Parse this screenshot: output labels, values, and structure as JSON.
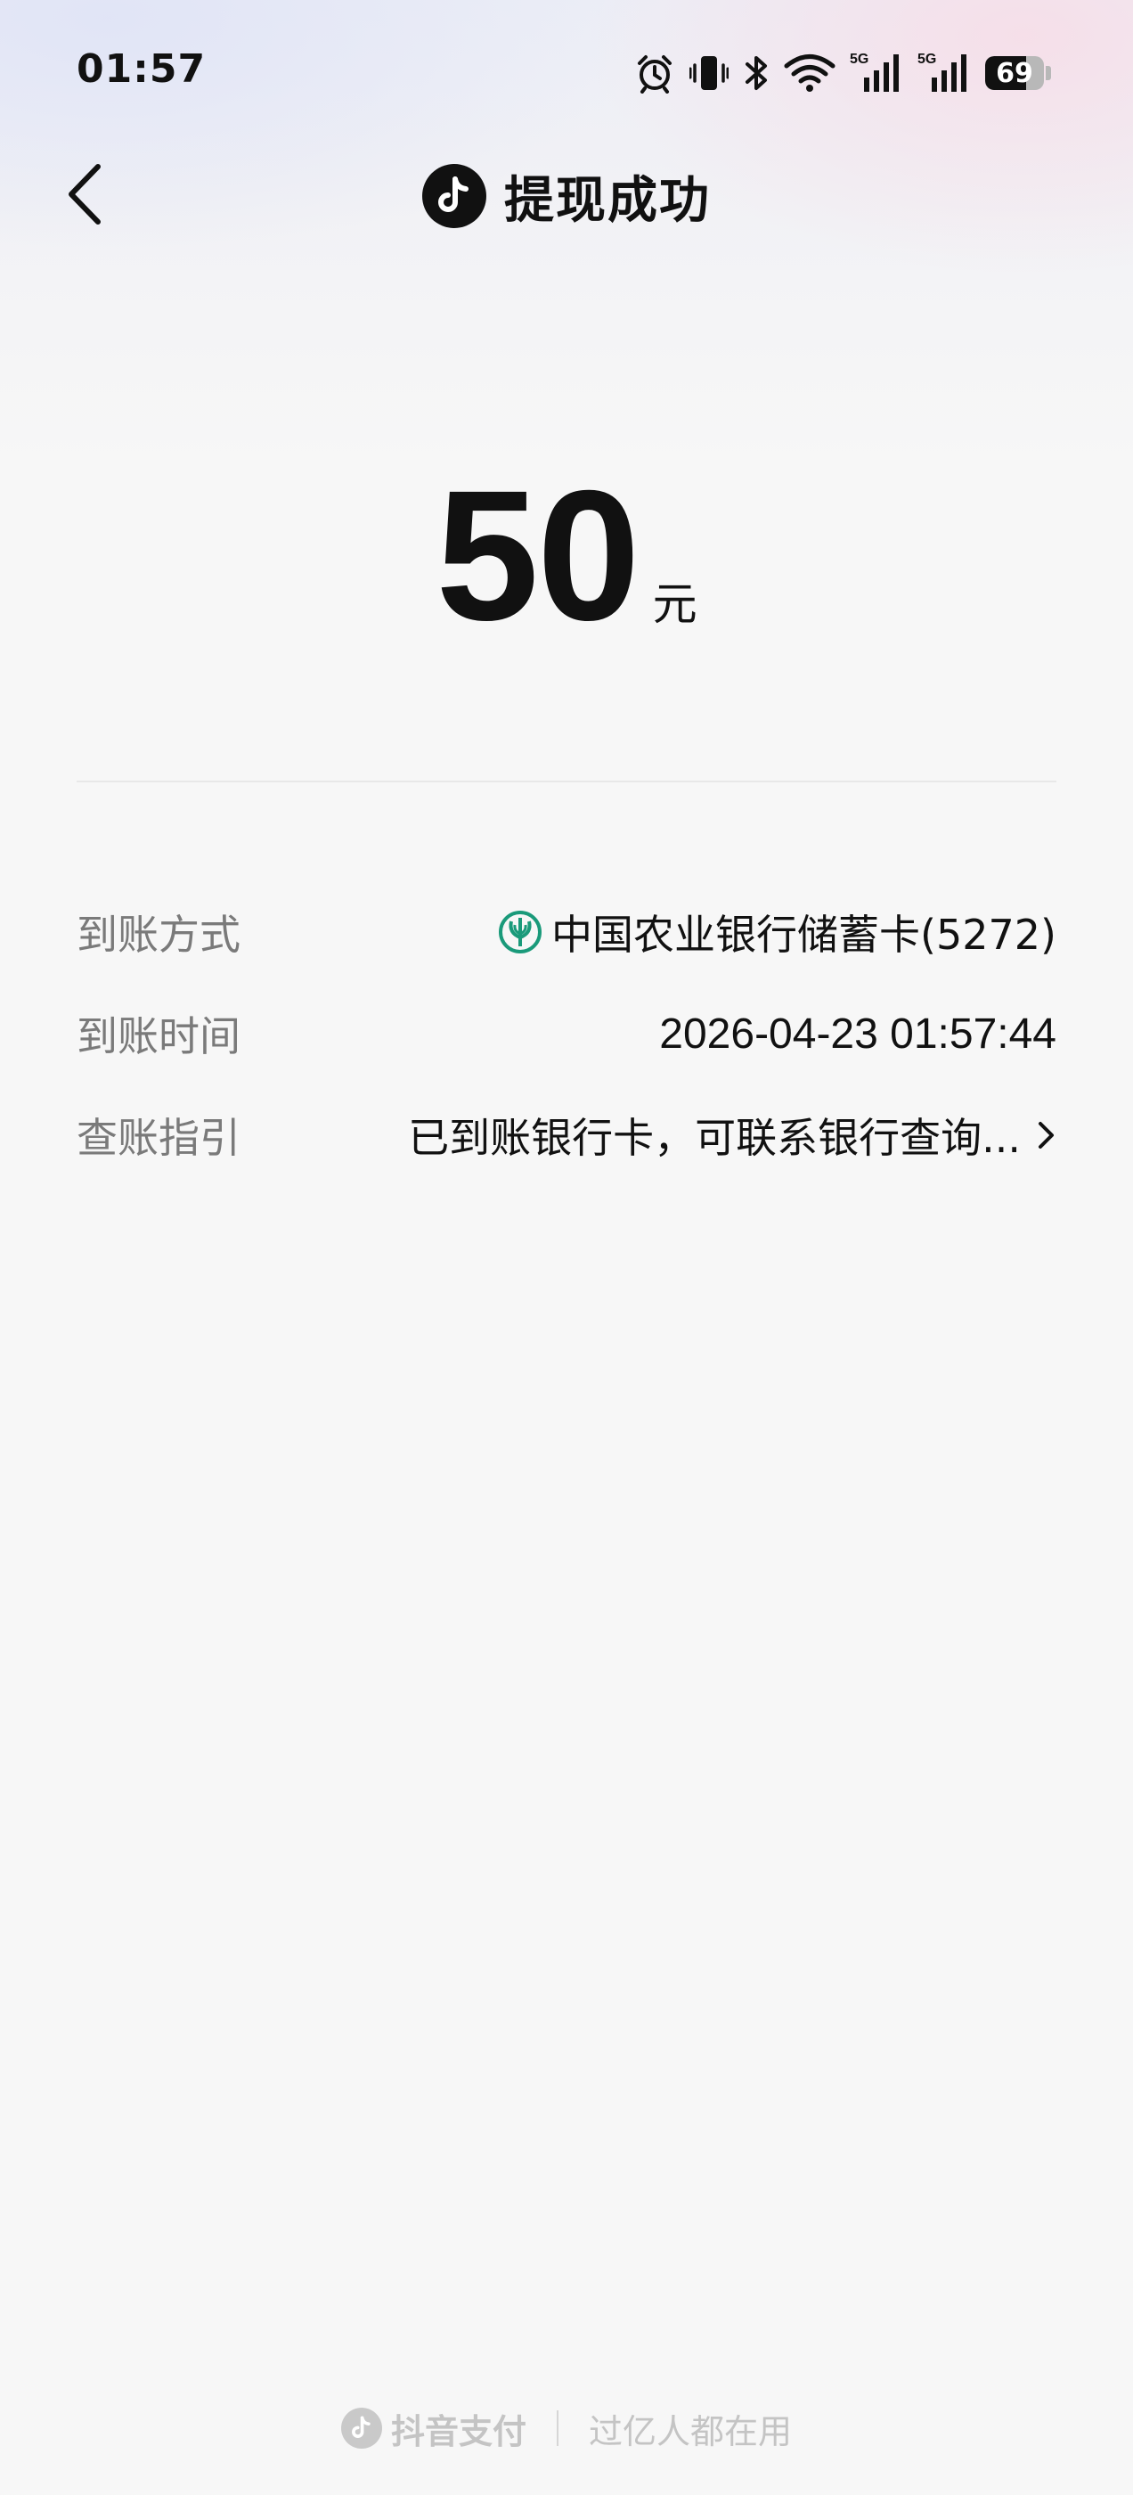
{
  "status_bar": {
    "time": "01:57",
    "icons": [
      "alarm-icon",
      "vibrate-icon",
      "bluetooth-icon",
      "wifi-icon",
      "signal-5g-icon",
      "signal-5g-icon"
    ],
    "network_label": "5G",
    "battery_level": "69",
    "battery_fraction": 0.69
  },
  "header": {
    "title": "提现成功",
    "logo_icon": "douyin-logo-icon",
    "back_icon": "chevron-left-icon"
  },
  "amount": {
    "value": "50",
    "unit": "元"
  },
  "details": {
    "method": {
      "label": "到账方式",
      "value": "中国农业银行储蓄卡(5272)",
      "icon": "abc-bank-logo-icon",
      "icon_color": "#1a9a7a"
    },
    "time": {
      "label": "到账时间",
      "value": "2026-04-23 01:57:44"
    },
    "guide": {
      "label": "查账指引",
      "value": "已到账银行卡，可联系银行查询...",
      "icon": "chevron-right-icon"
    }
  },
  "footer": {
    "brand": "抖音支付",
    "slogan": "过亿人都在用"
  },
  "colors": {
    "text_primary": "#111111",
    "text_secondary": "#7a7a7a",
    "footer_text": "#c4c4c4",
    "bank_green": "#1a9a7a"
  }
}
